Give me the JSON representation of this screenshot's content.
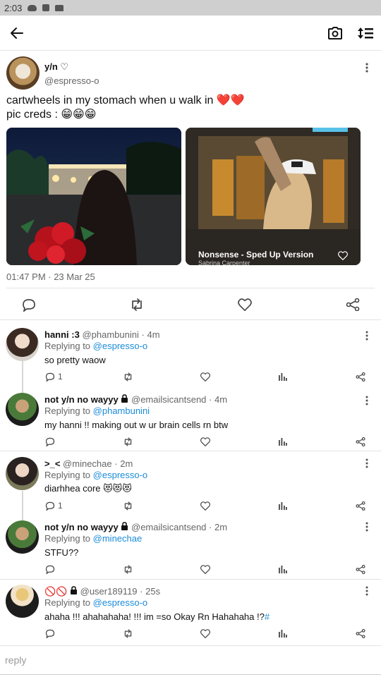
{
  "status_bar": {
    "time": "2:03"
  },
  "main_post": {
    "name": "y/n ♡",
    "handle": "@espresso-o",
    "text_line1": "cartwheels in my stomach when u walk in ❤️❤️",
    "text_line2": "pic creds : 😁😁😁",
    "song_title": "Nonsense - Sped Up Version",
    "song_artist": "Sabrina Carpenter",
    "timestamp": "01:47 PM · 23 Mar 25"
  },
  "replies": [
    {
      "name": "hanni :3",
      "handle": "@phambunini",
      "time": "4m",
      "replying_prefix": "Replying to ",
      "replying_to": "@espresso-o",
      "text": "so pretty waow",
      "reply_count": "1"
    },
    {
      "name": "not y/n no wayyy",
      "handle": "@emailsicantsend",
      "time": "4m",
      "replying_prefix": "Replying to ",
      "replying_to": "@phambunini",
      "text": "my hanni !! making out w ur brain cells rn btw",
      "reply_count": ""
    },
    {
      "name": ">_<",
      "handle": "@minechae",
      "time": "2m",
      "replying_prefix": "Replying to ",
      "replying_to": "@espresso-o",
      "text": "diarhhea core 😻😻😻",
      "reply_count": "1"
    },
    {
      "name": "not y/n no wayyy",
      "handle": "@emailsicantsend",
      "time": "2m",
      "replying_prefix": "Replying to ",
      "replying_to": "@minechae",
      "text": "STFU??",
      "reply_count": ""
    },
    {
      "name": "🚫🚫",
      "handle": "@user189119",
      "time": "25s",
      "replying_prefix": "Replying to ",
      "replying_to": "@espresso-o",
      "text": "ahaha !!! ahahahaha! !!! im =so Okay Rn Hahahaha !?",
      "text_tag": "#",
      "reply_count": ""
    }
  ],
  "reply_input": {
    "placeholder": "reply"
  },
  "colors": {
    "link": "#1a8cd8",
    "divider": "#e3e3e3",
    "heart": "#e0245e"
  },
  "icons": [
    "back-arrow-icon",
    "camera-icon",
    "sort-icon",
    "more-vertical-icon",
    "comment-icon",
    "retweet-icon",
    "heart-icon",
    "share-icon",
    "stats-icon",
    "lock-icon"
  ]
}
